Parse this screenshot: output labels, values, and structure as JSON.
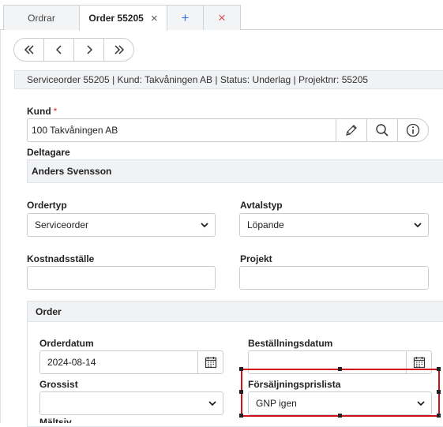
{
  "tabs": {
    "orders_label": "Ordrar",
    "active_label": "Order 55205",
    "close_glyph": "×",
    "add_glyph": "+",
    "close_all_glyph": "×"
  },
  "info_bar": "Serviceorder 55205 | Kund: Takvåningen AB | Status: Underlag | Projektnr: 55205",
  "fields": {
    "kund_label": "Kund",
    "kund_required": "*",
    "kund_value": "100 Takvåningen AB",
    "deltagare_label": "Deltagare",
    "deltagare_value": "Anders Svensson",
    "ordertyp_label": "Ordertyp",
    "ordertyp_value": "Serviceorder",
    "avtalstyp_label": "Avtalstyp",
    "avtalstyp_value": "Löpande",
    "kostnadsstalle_label": "Kostnadsställe",
    "kostnadsstalle_value": "",
    "projekt_label": "Projekt",
    "projekt_value": ""
  },
  "order_section": {
    "title": "Order",
    "orderdatum_label": "Orderdatum",
    "orderdatum_value": "2024-08-14",
    "bestallningsdatum_label": "Beställningsdatum",
    "bestallningsdatum_value": "",
    "grossist_label": "Grossist",
    "grossist_value": "",
    "forsaljningsprislista_label": "Försäljningsprislista",
    "forsaljningsprislista_value": "GNP igen",
    "partial_label": "Mältsiv"
  },
  "colors": {
    "highlight": "#d0101a",
    "required": "#d9342b",
    "accent_icon": "#3a6fd6",
    "close_icon": "#d9534f"
  }
}
